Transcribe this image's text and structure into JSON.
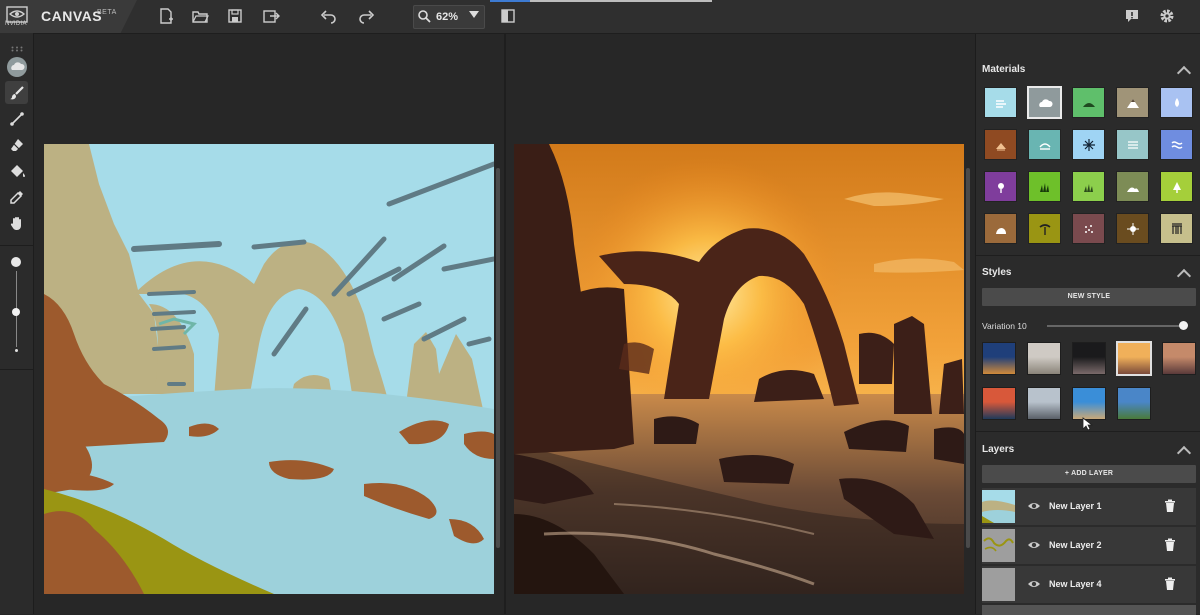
{
  "app": {
    "vendor": "NVIDIA",
    "name": "CANVAS",
    "badge": "BETA"
  },
  "toolbar": {
    "zoom_value": "62%",
    "buttons": [
      "new-file-icon",
      "open-folder-icon",
      "save-icon",
      "export-icon",
      "undo-icon",
      "redo-icon",
      "zoom-icon",
      "compare-icon",
      "feedback-icon",
      "settings-icon"
    ]
  },
  "tools": [
    "material-picker-icon",
    "brush-icon",
    "line-icon",
    "eraser-icon",
    "fill-bucket-icon",
    "eyedropper-icon",
    "pan-hand-icon"
  ],
  "brush_size": {
    "level": 0.8
  },
  "materials": {
    "title": "Materials",
    "items": [
      {
        "name": "sky",
        "color": "#a6dce9"
      },
      {
        "name": "cloud",
        "color": "#8f9a9c",
        "selected": true
      },
      {
        "name": "grass-hill",
        "color": "#5fbf6b"
      },
      {
        "name": "mountain",
        "color": "#a09478"
      },
      {
        "name": "water-drop",
        "color": "#a9c2f2"
      },
      {
        "name": "dirt",
        "color": "#8f4a22"
      },
      {
        "name": "sea",
        "color": "#69b5b2"
      },
      {
        "name": "snow",
        "color": "#9fd4f4"
      },
      {
        "name": "fog",
        "color": "#97c6c8"
      },
      {
        "name": "river",
        "color": "#6f8de0"
      },
      {
        "name": "flower",
        "color": "#7f3d9c"
      },
      {
        "name": "grass",
        "color": "#6ec02a"
      },
      {
        "name": "bush",
        "color": "#8ccf4c"
      },
      {
        "name": "hill",
        "color": "#7d8c56"
      },
      {
        "name": "tree",
        "color": "#a5cf3a"
      },
      {
        "name": "rock",
        "color": "#9b6a3b"
      },
      {
        "name": "palm",
        "color": "#9a9513"
      },
      {
        "name": "gravel",
        "color": "#7a4a4e"
      },
      {
        "name": "stone",
        "color": "#6a4c1f"
      },
      {
        "name": "building",
        "color": "#c6bf8c"
      }
    ]
  },
  "styles": {
    "title": "Styles",
    "new_style_label": "NEW STYLE",
    "variation_label": "Variation 10",
    "variation_level": 1.0,
    "thumbnails": [
      {
        "name": "style-1",
        "c1": "#1f3f7a",
        "c2": "#d08a3a"
      },
      {
        "name": "style-2",
        "c1": "#cfcac4",
        "c2": "#8a8479"
      },
      {
        "name": "style-3",
        "c1": "#1a1a1c",
        "c2": "#7a6a6a"
      },
      {
        "name": "style-4",
        "c1": "#f0b05a",
        "c2": "#7a4a3a",
        "selected": true
      },
      {
        "name": "style-5",
        "c1": "#c58a6a",
        "c2": "#5a3a3a"
      },
      {
        "name": "style-6",
        "c1": "#d8583a",
        "c2": "#1f3a5a"
      },
      {
        "name": "style-7",
        "c1": "#b8c2cc",
        "c2": "#5a6068"
      },
      {
        "name": "style-8",
        "c1": "#3a8ed8",
        "c2": "#c8a878"
      },
      {
        "name": "style-9",
        "c1": "#4a86c8",
        "c2": "#4a7a3a"
      }
    ]
  },
  "layers": {
    "title": "Layers",
    "add_label": "+ ADD LAYER",
    "items": [
      {
        "name": "New Layer 1"
      },
      {
        "name": "New Layer 2"
      },
      {
        "name": "New Layer 4"
      }
    ]
  }
}
